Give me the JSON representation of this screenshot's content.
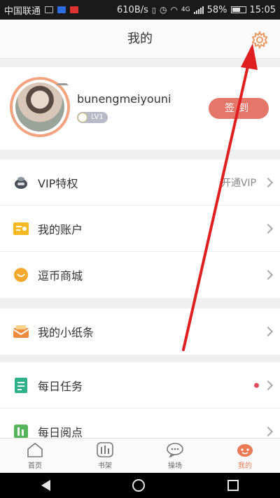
{
  "status_bar": {
    "carrier": "中国联通",
    "net_speed": "610B/s",
    "battery": "58%",
    "network_type": "4G",
    "time": "15:05"
  },
  "header": {
    "title": "我的"
  },
  "profile": {
    "username": "bunengmeiyouni",
    "level": "LV1",
    "signin_label": "签到"
  },
  "menu_group_1": [
    {
      "label": "VIP特权",
      "right_text": "开通VIP",
      "icon": "vip-icon"
    },
    {
      "label": "我的账户",
      "right_text": "",
      "icon": "account-icon"
    },
    {
      "label": "逗币商城",
      "right_text": "",
      "icon": "shop-icon"
    }
  ],
  "menu_group_2": [
    {
      "label": "我的小纸条",
      "right_text": "",
      "icon": "note-icon"
    }
  ],
  "menu_group_3": [
    {
      "label": "每日任务",
      "right_text": "",
      "icon": "task-icon",
      "has_dot": true
    },
    {
      "label": "每日阅点",
      "right_text": "",
      "icon": "read-icon"
    }
  ],
  "tab_bar": [
    {
      "label": "首页",
      "icon": "home-icon",
      "active": false
    },
    {
      "label": "书架",
      "icon": "bookshelf-icon",
      "active": false
    },
    {
      "label": "操场",
      "icon": "playground-icon",
      "active": false
    },
    {
      "label": "我的",
      "icon": "me-icon",
      "active": true
    }
  ],
  "colors": {
    "accent": "#ea7b57",
    "signin_button": "#e4766a",
    "annotation_arrow": "#e02020",
    "notification_dot": "#e14a5b"
  }
}
